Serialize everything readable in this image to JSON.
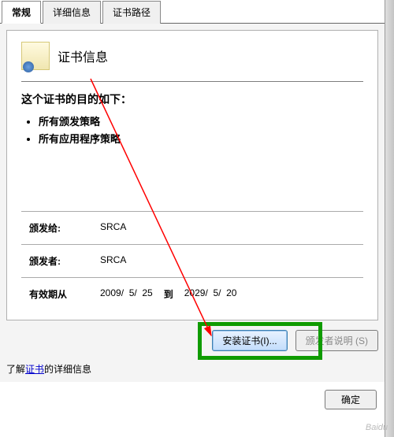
{
  "tabs": {
    "general": "常规",
    "details": "详细信息",
    "cert_path": "证书路径"
  },
  "cert": {
    "title": "证书信息",
    "purpose_heading": "这个证书的目的如下：",
    "purposes": [
      "所有颁发策略",
      "所有应用程序策略"
    ],
    "issued_to_label": "颁发给:",
    "issued_to_value": "SRCA",
    "issuer_label": "颁发者:",
    "issuer_value": "SRCA",
    "valid_from_label": "有效期从",
    "valid_from_value": "2009/  5/  25",
    "valid_to_label": "到",
    "valid_to_value": "2029/  5/  20"
  },
  "buttons": {
    "install": "安装证书(I)...",
    "issuer_statement": "颁发者说明 (S)",
    "ok": "确定"
  },
  "link_text": {
    "prefix": "了解",
    "link": "证书",
    "suffix": "的详细信息"
  },
  "watermark": "Baidu"
}
